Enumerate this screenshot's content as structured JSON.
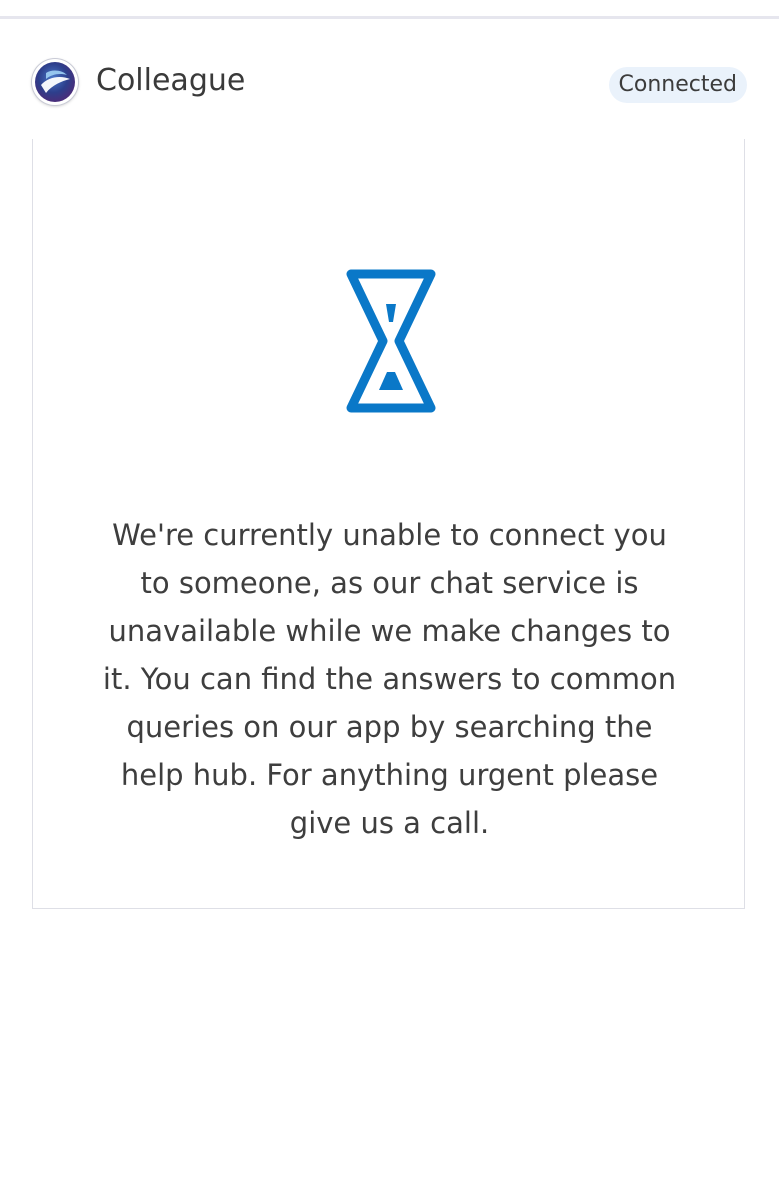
{
  "header": {
    "agent_name": "Colleague",
    "status": "Connected"
  },
  "icons": {
    "avatar": "company-logo-avatar",
    "waiting": "hourglass-icon"
  },
  "colors": {
    "accent": "#0a78c8",
    "badge_background": "#eaf2fb",
    "text": "#3e3e3e"
  },
  "message": {
    "text": "We're currently unable to connect you to someone, as our chat service is unavailable while we make changes to it. You can find the answers to common queries on our app by searching the help hub. For anything urgent please give us a call."
  }
}
